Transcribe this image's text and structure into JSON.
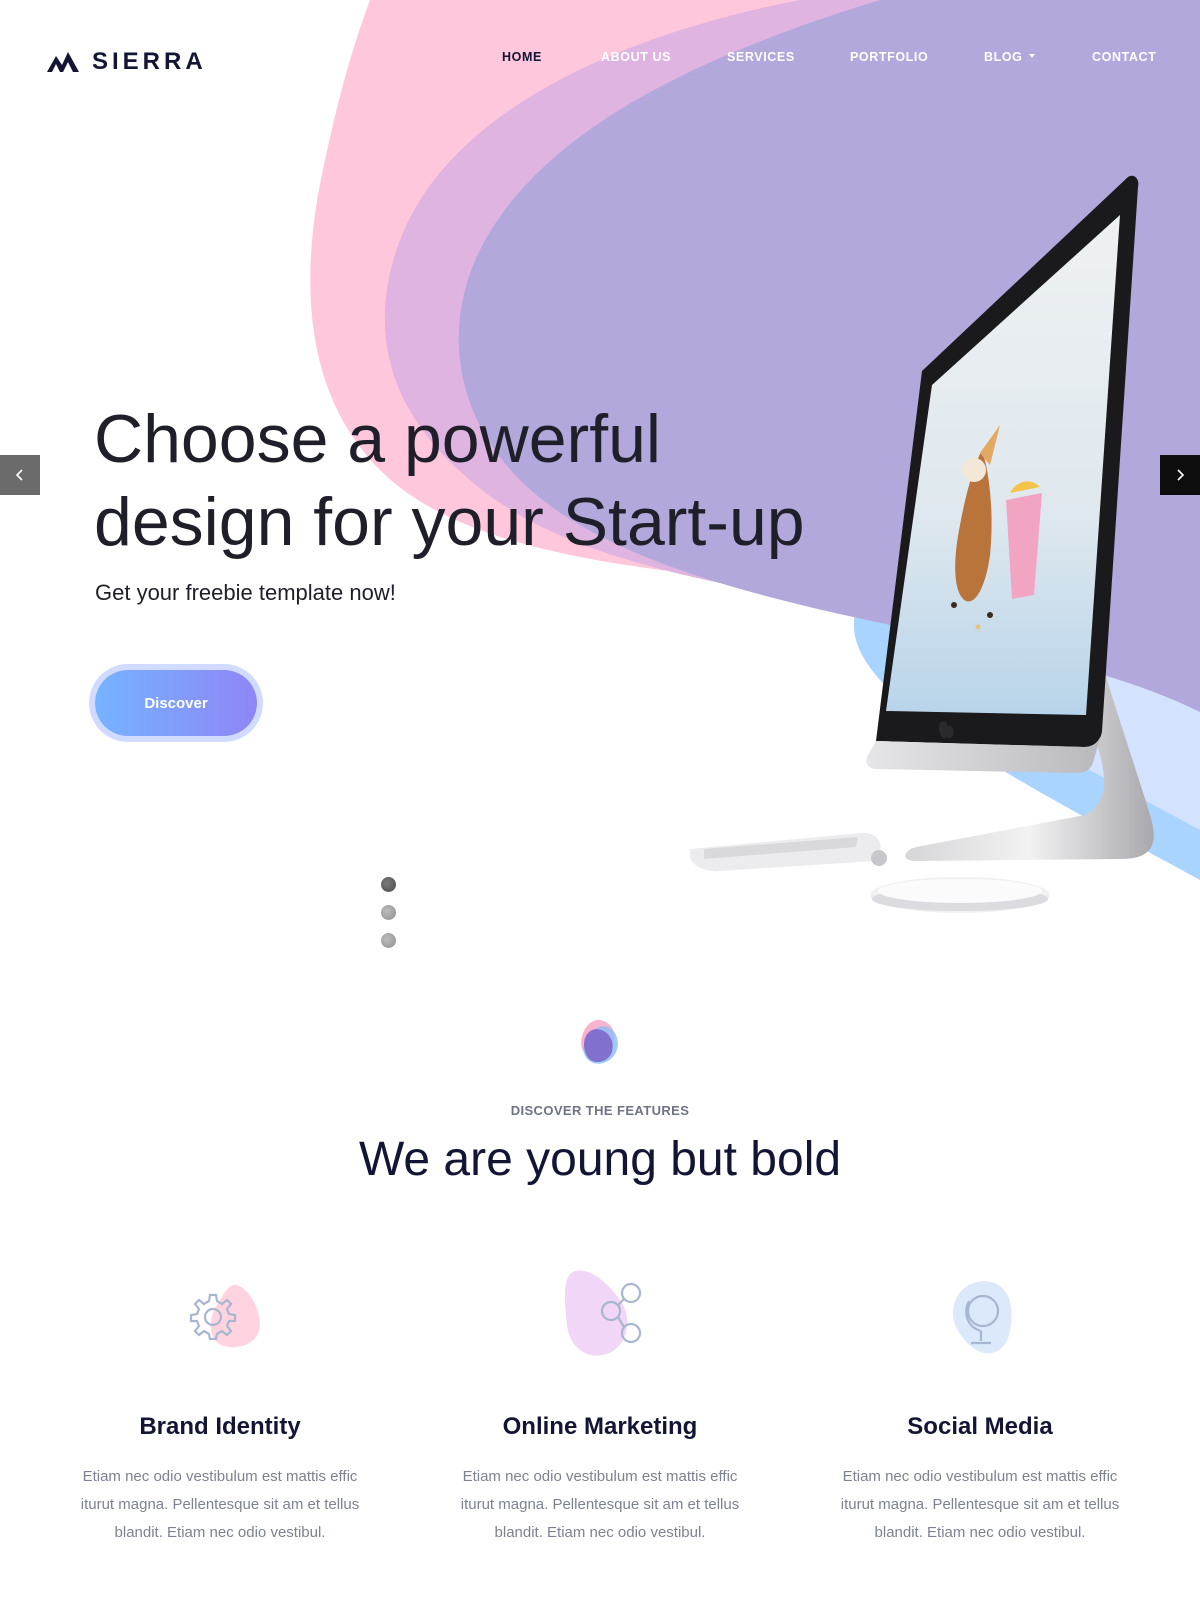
{
  "brand": {
    "name": "SIERRA",
    "logo_icon": "mountain-icon"
  },
  "nav": {
    "items": [
      {
        "label": "HOME",
        "active": true
      },
      {
        "label": "ABOUT US",
        "active": false
      },
      {
        "label": "SERVICES",
        "active": false
      },
      {
        "label": "PORTFOLIO",
        "active": false
      },
      {
        "label": "BLOG",
        "active": false,
        "dropdown": true
      },
      {
        "label": "CONTACT",
        "active": false
      }
    ]
  },
  "hero": {
    "title_line1": "Choose a powerful",
    "title_line2": "design for your Start-up",
    "subtitle": "Get your freebie template now!",
    "cta_label": "Discover",
    "slides_total": 3,
    "active_slide": 1
  },
  "features": {
    "eyebrow": "DISCOVER THE FEATURES",
    "title": "We are young but bold",
    "cards": [
      {
        "icon": "gear-icon",
        "title": "Brand Identity",
        "text": "Etiam nec odio vestibulum est mattis effic iturut magna. Pellentesque sit am et tellus blandit. Etiam nec odio vestibul."
      },
      {
        "icon": "share-icon",
        "title": "Online Marketing",
        "text": "Etiam nec odio vestibulum est mattis effic iturut magna. Pellentesque sit am et tellus blandit. Etiam nec odio vestibul."
      },
      {
        "icon": "globe-icon",
        "title": "Social Media",
        "text": "Etiam nec odio vestibulum est mattis effic iturut magna. Pellentesque sit am et tellus blandit. Etiam nec odio vestibul."
      }
    ]
  },
  "colors": {
    "navy": "#131535",
    "pink_wave": "#ffc7dc",
    "purple_wave": "#b2a8dc",
    "blue_wave": "#a8d4ff",
    "button_start": "#75b3ff",
    "button_end": "#8e86f5"
  }
}
